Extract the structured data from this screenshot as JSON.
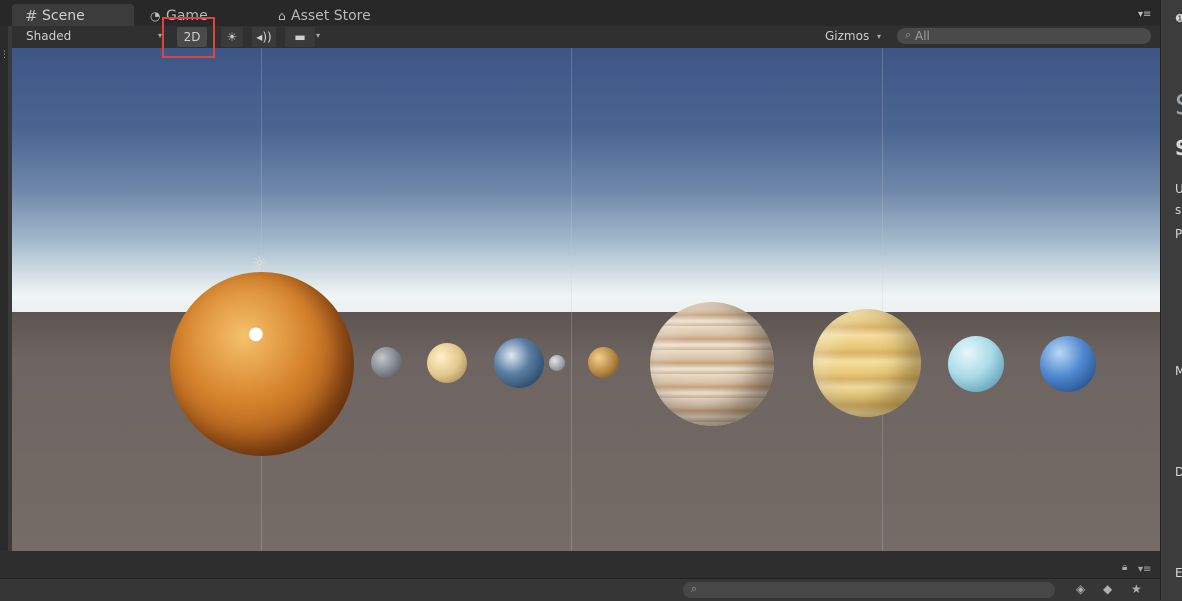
{
  "tabs": {
    "scene": "Scene",
    "game": "Game",
    "asset_store": "Asset Store"
  },
  "toolbar": {
    "shading_mode": "Shaded",
    "mode_2d": "2D",
    "gizmos": "Gizmos",
    "search_placeholder": "All"
  },
  "right_panel": {
    "fragments": [
      "S",
      "S",
      "U",
      "s",
      "P",
      "M",
      "D",
      "E"
    ]
  },
  "colors": {
    "highlight": "#e04141",
    "editor_dark": "#282828",
    "toolbar": "#303030"
  }
}
